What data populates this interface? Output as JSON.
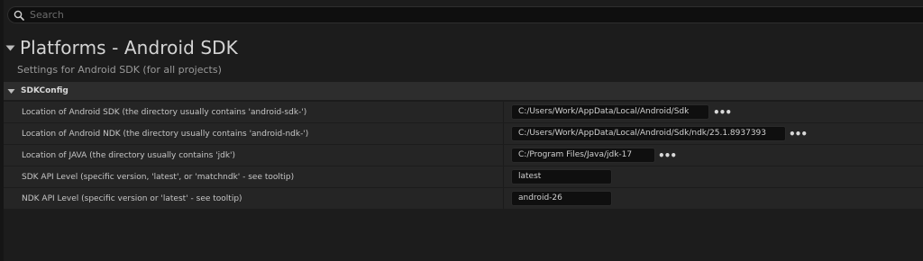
{
  "search": {
    "placeholder": "Search",
    "value": ""
  },
  "section": {
    "title": "Platforms - Android SDK",
    "subtitle": "Settings for Android SDK (for all projects)"
  },
  "category": {
    "label": "SDKConfig"
  },
  "rows": [
    {
      "label": "Location of Android SDK (the directory usually contains 'android-sdk-')",
      "value": "C:/Users/Work/AppData/Local/Android/Sdk",
      "browse": "•••"
    },
    {
      "label": "Location of Android NDK (the directory usually contains 'android-ndk-')",
      "value": "C:/Users/Work/AppData/Local/Android/Sdk/ndk/25.1.8937393",
      "browse": "•••"
    },
    {
      "label": "Location of JAVA (the directory usually contains 'jdk')",
      "value": "C:/Program Files/Java/jdk-17",
      "browse": "•••"
    },
    {
      "label": "SDK API Level (specific version, 'latest', or 'matchndk' - see tooltip)",
      "value": "latest"
    },
    {
      "label": "NDK API Level (specific version or 'latest' - see tooltip)",
      "value": "android-26"
    }
  ],
  "icons": {
    "search": "search-icon",
    "section_toggle": "caret-down-icon",
    "category_toggle": "caret-down-icon",
    "browse": "ellipsis-icon"
  },
  "colors": {
    "background": "#1c1c1c",
    "row": "#252525",
    "category_bar": "#2d2d2d",
    "field": "#0f0f0f",
    "text": "#c6c6c6"
  }
}
